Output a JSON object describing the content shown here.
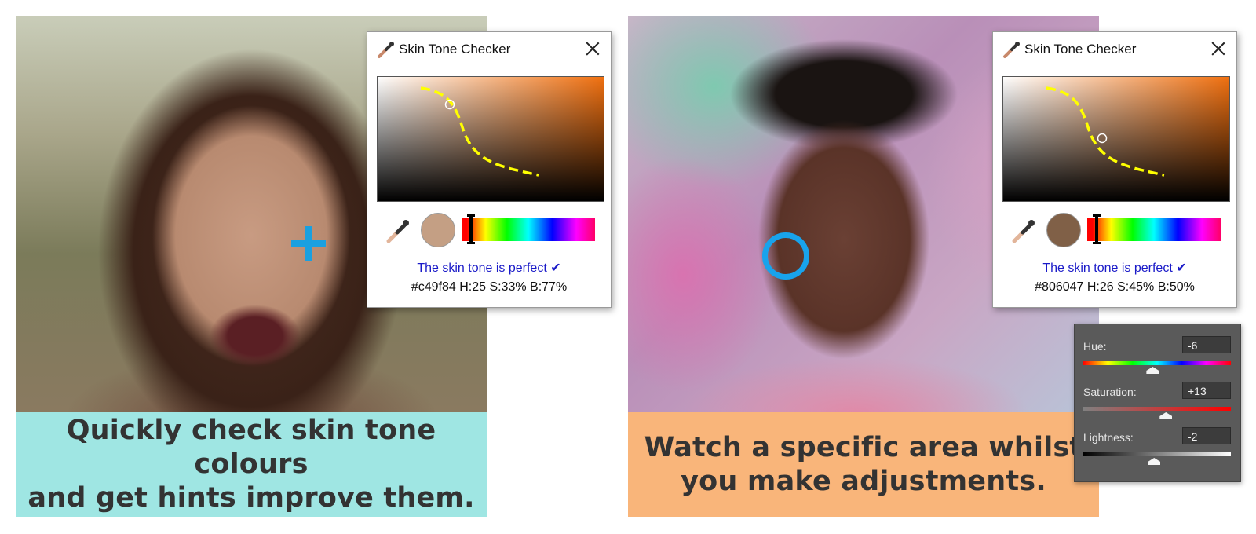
{
  "left_panel": {
    "caption_line1": "Quickly check skin tone colours",
    "caption_line2": "and get hints improve them.",
    "caption_bg": "#9fe6e3",
    "marker": "plus-crosshair-icon",
    "checker": {
      "title": "Skin Tone Checker",
      "status": "The skin tone is perfect ✔",
      "info": "#c49f84 H:25 S:33% B:77%",
      "swatch_color": "#c49f84",
      "field_hue_color": "#f07010",
      "hue_position": 0.06
    }
  },
  "right_panel": {
    "caption_line1": "Watch a specific area whilst",
    "caption_line2": "you make adjustments.",
    "caption_bg": "#f9b57a",
    "marker": "ring-marker-icon",
    "checker": {
      "title": "Skin Tone Checker",
      "status": "The skin tone is perfect ✔",
      "info": "#806047 H:26 S:45% B:50%",
      "swatch_color": "#806047",
      "field_hue_color": "#f07010",
      "hue_position": 0.06
    }
  },
  "hsl_panel": {
    "hue_label": "Hue:",
    "hue_value": "-6",
    "hue_level": 0.47,
    "saturation_label": "Saturation:",
    "saturation_value": "+13",
    "saturation_level": 0.56,
    "lightness_label": "Lightness:",
    "lightness_value": "-2",
    "lightness_level": 0.48
  }
}
